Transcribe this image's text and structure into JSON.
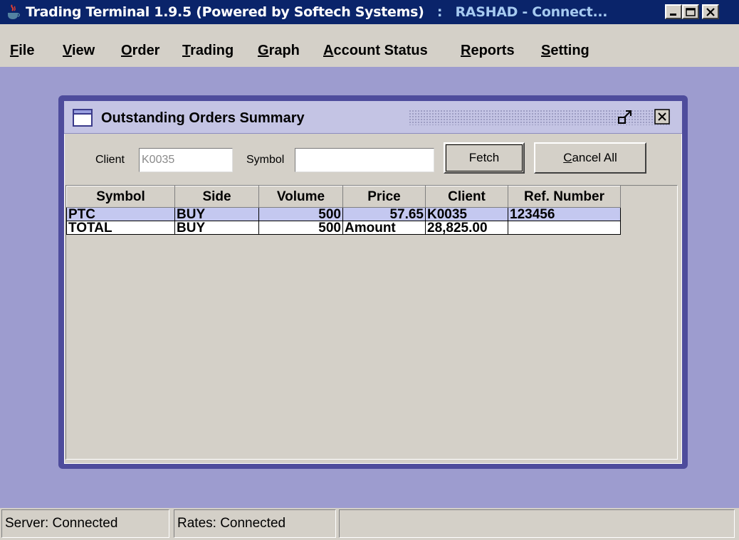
{
  "window": {
    "title": "Trading Terminal 1.9.5 (Powered by Softech Systems)",
    "separator": ":",
    "user_status": "RASHAD - Connect...",
    "icon": "java-cup-icon",
    "controls": {
      "minimize": "minimize-icon",
      "maximize": "maximize-icon",
      "close": "close-icon"
    }
  },
  "menu": {
    "items": [
      {
        "mnemonic": "F",
        "rest": "ile"
      },
      {
        "mnemonic": "V",
        "rest": "iew"
      },
      {
        "mnemonic": "O",
        "rest": "rder"
      },
      {
        "mnemonic": "T",
        "rest": "rading"
      },
      {
        "mnemonic": "G",
        "rest": "raph"
      },
      {
        "mnemonic": "A",
        "rest": "ccount Status"
      },
      {
        "mnemonic": "R",
        "rest": "eports"
      },
      {
        "mnemonic": "S",
        "rest": "etting"
      }
    ]
  },
  "dialog": {
    "title": "Outstanding Orders Summary",
    "client_label": "Client",
    "client_value": "K0035",
    "symbol_label": "Symbol",
    "symbol_value": "",
    "fetch_label": "Fetch",
    "cancel_all_mnemonic": "C",
    "cancel_all_rest": "ancel All"
  },
  "table": {
    "columns": [
      "Symbol",
      "Side",
      "Volume",
      "Price",
      "Client",
      "Ref. Number"
    ],
    "rows": [
      [
        "PTC",
        "BUY",
        "500",
        "57.65",
        "K0035",
        "123456"
      ],
      [
        "TOTAL",
        "BUY",
        "500",
        "Amount",
        "28,825.00",
        ""
      ]
    ]
  },
  "status": {
    "server": "Server: Connected",
    "rates": "Rates: Connected",
    "extra": ""
  },
  "colors": {
    "titlebar": "#0a246a",
    "desktop": "#9d9ccf",
    "frame_border": "#4e4c9c",
    "frame_titlebar": "#c4c4e4",
    "selected_row": "#c4c8f0"
  }
}
